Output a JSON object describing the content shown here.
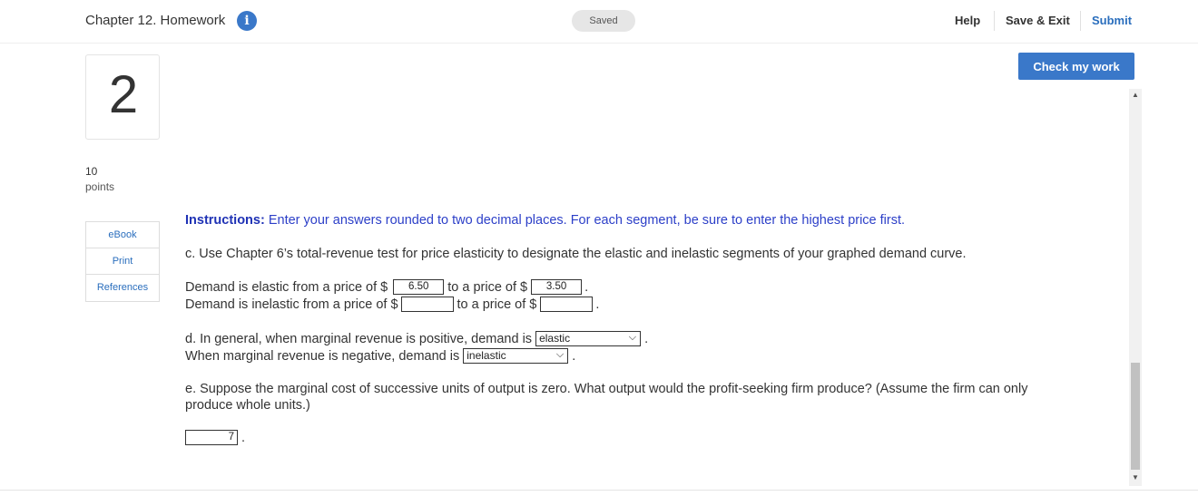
{
  "header": {
    "title": "Chapter 12. Homework",
    "info_icon": "info-icon",
    "status": "Saved",
    "nav": {
      "help": "Help",
      "save_exit": "Save & Exit",
      "submit": "Submit"
    }
  },
  "question": {
    "number": "2",
    "points_value": "10",
    "points_label": "points",
    "check_button": "Check my work",
    "resources": [
      "eBook",
      "Print",
      "References"
    ]
  },
  "content": {
    "instructions_bold": "Instructions:",
    "instructions_text": " Enter your answers rounded to two decimal places. For each segment, be sure to enter the highest price first.",
    "part_c": "c. Use Chapter 6’s total-revenue test for price elasticity to designate the elastic and inelastic segments of your graphed demand curve.",
    "elastic_prefix": "Demand is elastic from a price of $",
    "elastic_from": "6.50",
    "elastic_mid": "to a price of $",
    "elastic_to": "3.50",
    "inelastic_prefix": "Demand is inelastic from a price of $",
    "inelastic_from": "",
    "inelastic_mid": "to a price of $",
    "inelastic_to": "",
    "part_d_1": "d. In general, when marginal revenue is positive, demand is",
    "part_d_1_value": "elastic",
    "part_d_2": "When marginal revenue is negative, demand is",
    "part_d_2_value": "inelastic",
    "part_e": "e. Suppose the marginal cost of successive units of output is zero. What output would the profit-seeking firm produce? (Assume the firm can only produce whole units.)",
    "part_e_value": "7",
    "period": "."
  },
  "colors": {
    "accent": "#3a78c9",
    "link": "#2a6ebd",
    "instructions": "#2c3fc8"
  }
}
